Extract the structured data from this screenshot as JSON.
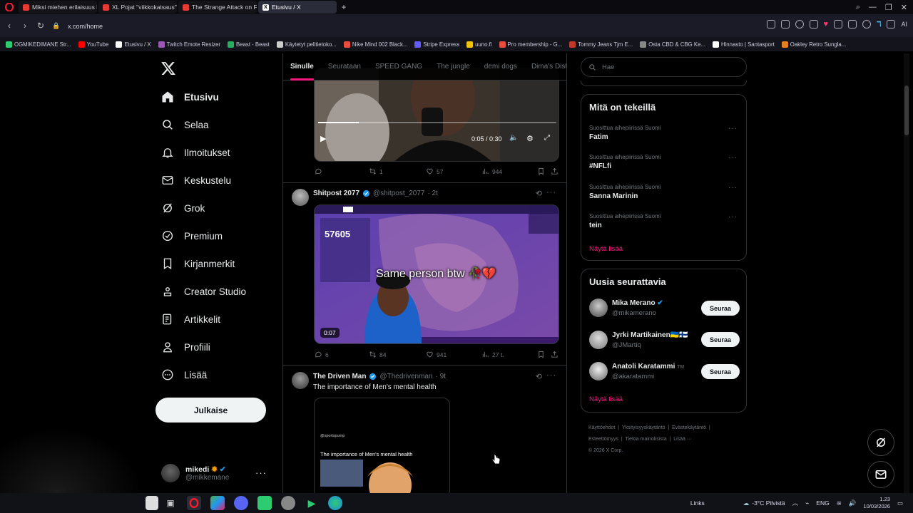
{
  "browser": {
    "tabs": [
      {
        "label": "Miksi miehen erilaisuus k",
        "color": "#e53935"
      },
      {
        "label": "XL Pojat \"viikkokatsaus\" E",
        "color": "#e53935"
      },
      {
        "label": "The Strange Attack on Flig",
        "color": "#e53935"
      },
      {
        "label": "Etusivu / X",
        "color": "#ffffff",
        "active": true
      }
    ],
    "url": "x.com/home",
    "bookmarks": [
      {
        "label": "OGMIKEDIMANE Str...",
        "color": "#2ecc71"
      },
      {
        "label": "YouTube",
        "color": "#ff0000"
      },
      {
        "label": "Etusivu / X",
        "color": "#ffffff"
      },
      {
        "label": "Twitch Emote Resizer",
        "color": "#9b59b6"
      },
      {
        "label": "Beast - Beast",
        "color": "#27ae60"
      },
      {
        "label": "Käytetyt pelitietoko...",
        "color": "#cccccc"
      },
      {
        "label": "Nike Mind 002 Black...",
        "color": "#e74c3c"
      },
      {
        "label": "Stripe Express",
        "color": "#635bff"
      },
      {
        "label": "uuno.fi",
        "color": "#f1c40f"
      },
      {
        "label": "Pro membership - G...",
        "color": "#e74c3c"
      },
      {
        "label": "Tommy Jeans Tjm E...",
        "color": "#c0392b"
      },
      {
        "label": "Osta CBD & CBG Ke...",
        "color": "#888888"
      },
      {
        "label": "Hinnasto | Santasport",
        "color": "#ffffff"
      },
      {
        "label": "Oakley Retro Sunglа...",
        "color": "#e67e22"
      }
    ],
    "extension_label": "AI"
  },
  "sidebar": {
    "items": [
      {
        "label": "Etusivu",
        "icon": "home-icon"
      },
      {
        "label": "Selaa",
        "icon": "search-icon"
      },
      {
        "label": "Ilmoitukset",
        "icon": "bell-icon"
      },
      {
        "label": "Keskustelu",
        "icon": "mail-icon"
      },
      {
        "label": "Grok",
        "icon": "grok-icon"
      },
      {
        "label": "Premium",
        "icon": "premium-icon"
      },
      {
        "label": "Kirjanmerkit",
        "icon": "bookmark-icon"
      },
      {
        "label": "Creator Studio",
        "icon": "creator-studio-icon"
      },
      {
        "label": "Artikkelit",
        "icon": "articles-icon"
      },
      {
        "label": "Profiili",
        "icon": "profile-icon"
      },
      {
        "label": "Lisää",
        "icon": "more-icon"
      }
    ],
    "post_label": "Julkaise",
    "profile": {
      "name": "mikedi",
      "handle": "@mikkemane"
    }
  },
  "feed": {
    "tabs": [
      "Sinulle",
      "Seurataan",
      "SPEED GANG",
      "The jungle",
      "demi dogs",
      "Dima's Dist"
    ],
    "tweet1": {
      "time": "0:05 / 0:30",
      "progress": 0.17,
      "replies": "",
      "retweets": "1",
      "likes": "57",
      "views": "944"
    },
    "tweet2": {
      "name": "Shitpost 2077",
      "handle": "@shitpost_2077",
      "age": "· 2t",
      "overlay": "Same person btw",
      "hud_number": "57605",
      "duration": "0:07",
      "replies": "6",
      "retweets": "84",
      "likes": "941",
      "views": "27 t."
    },
    "tweet3": {
      "name": "The Driven Man",
      "handle": "@Thedrivenman",
      "age": "· 9t",
      "text": "The importance of Men's mental health",
      "inner_handle": "@sportspump",
      "inner_title": "The importance of Men's mental health"
    }
  },
  "right": {
    "search_placeholder": "Hae",
    "trends_title": "Mitä on tekeillä",
    "trends": [
      {
        "context": "Suosittua aihepiirissä Suomi",
        "name": "Fatim"
      },
      {
        "context": "Suosittua aihepiirissä Suomi",
        "name": "#NFLfi"
      },
      {
        "context": "Suosittua aihepiirissä Suomi",
        "name": "Sanna Marinin"
      },
      {
        "context": "Suosittua aihepiirissä Suomi",
        "name": "tein"
      }
    ],
    "show_more": "Näytä lisää",
    "who_title": "Uusia seurattavia",
    "who": [
      {
        "name": "Mika Merano",
        "handle": "@mikamerano",
        "verified": true
      },
      {
        "name": "Jyrki Martikainen🇺🇦🇫🇮",
        "handle": "@JMartiq",
        "verified": false
      },
      {
        "name": "Anatoli Karatammi",
        "handle": "@akaratammi",
        "verified": false
      }
    ],
    "follow_label": "Seuraa",
    "footer": {
      "l1": "Käyttöehdot",
      "l2": "Yksityisyyskäytäntö",
      "l3": "Evästekäytäntö",
      "l4": "Esteettömyys",
      "l5": "Tietoa mainoksista",
      "l6": "Lisää ···",
      "copyright": "© 2026 X Corp."
    }
  },
  "taskbar": {
    "links": "Links",
    "weather": "-3°C  Pilvistä",
    "lang": "ENG",
    "time": "1.23",
    "date": "10/03/2026"
  }
}
